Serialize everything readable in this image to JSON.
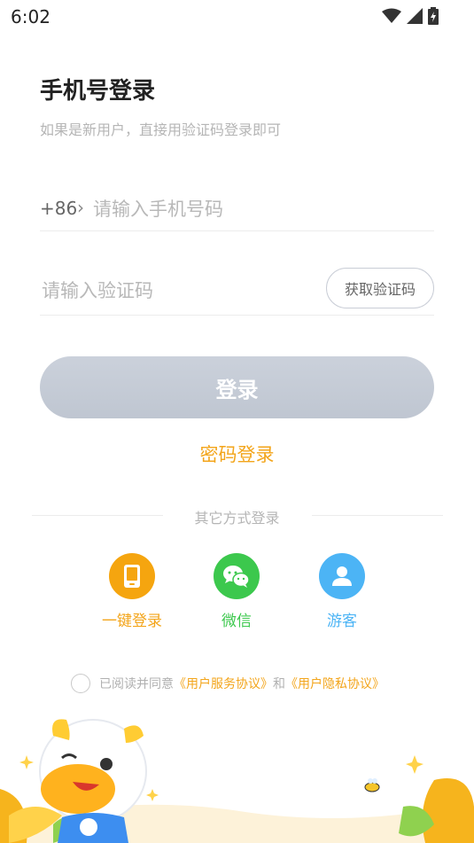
{
  "status": {
    "time": "6:02"
  },
  "header": {
    "title": "手机号登录",
    "subtitle": "如果是新用户，直接用验证码登录即可"
  },
  "phone": {
    "prefix": "+86",
    "placeholder": "请输入手机号码"
  },
  "code": {
    "placeholder": "请输入验证码",
    "get_code_label": "获取验证码"
  },
  "login_button": "登录",
  "password_login": "密码登录",
  "other": {
    "label": "其它方式登录",
    "options": [
      {
        "label": "一键登录",
        "icon": "phone-icon",
        "color": "#f5a50f"
      },
      {
        "label": "微信",
        "icon": "wechat-icon",
        "color": "#3cc84d"
      },
      {
        "label": "游客",
        "icon": "user-icon",
        "color": "#4cb4f5"
      }
    ]
  },
  "agreement": {
    "prefix": "已阅读并同意",
    "service": "《用户服务协议》",
    "and": "和",
    "privacy": "《用户隐私协议》"
  },
  "colors": {
    "accent": "#f3a51b",
    "button_disabled": "#c6ccd6"
  }
}
